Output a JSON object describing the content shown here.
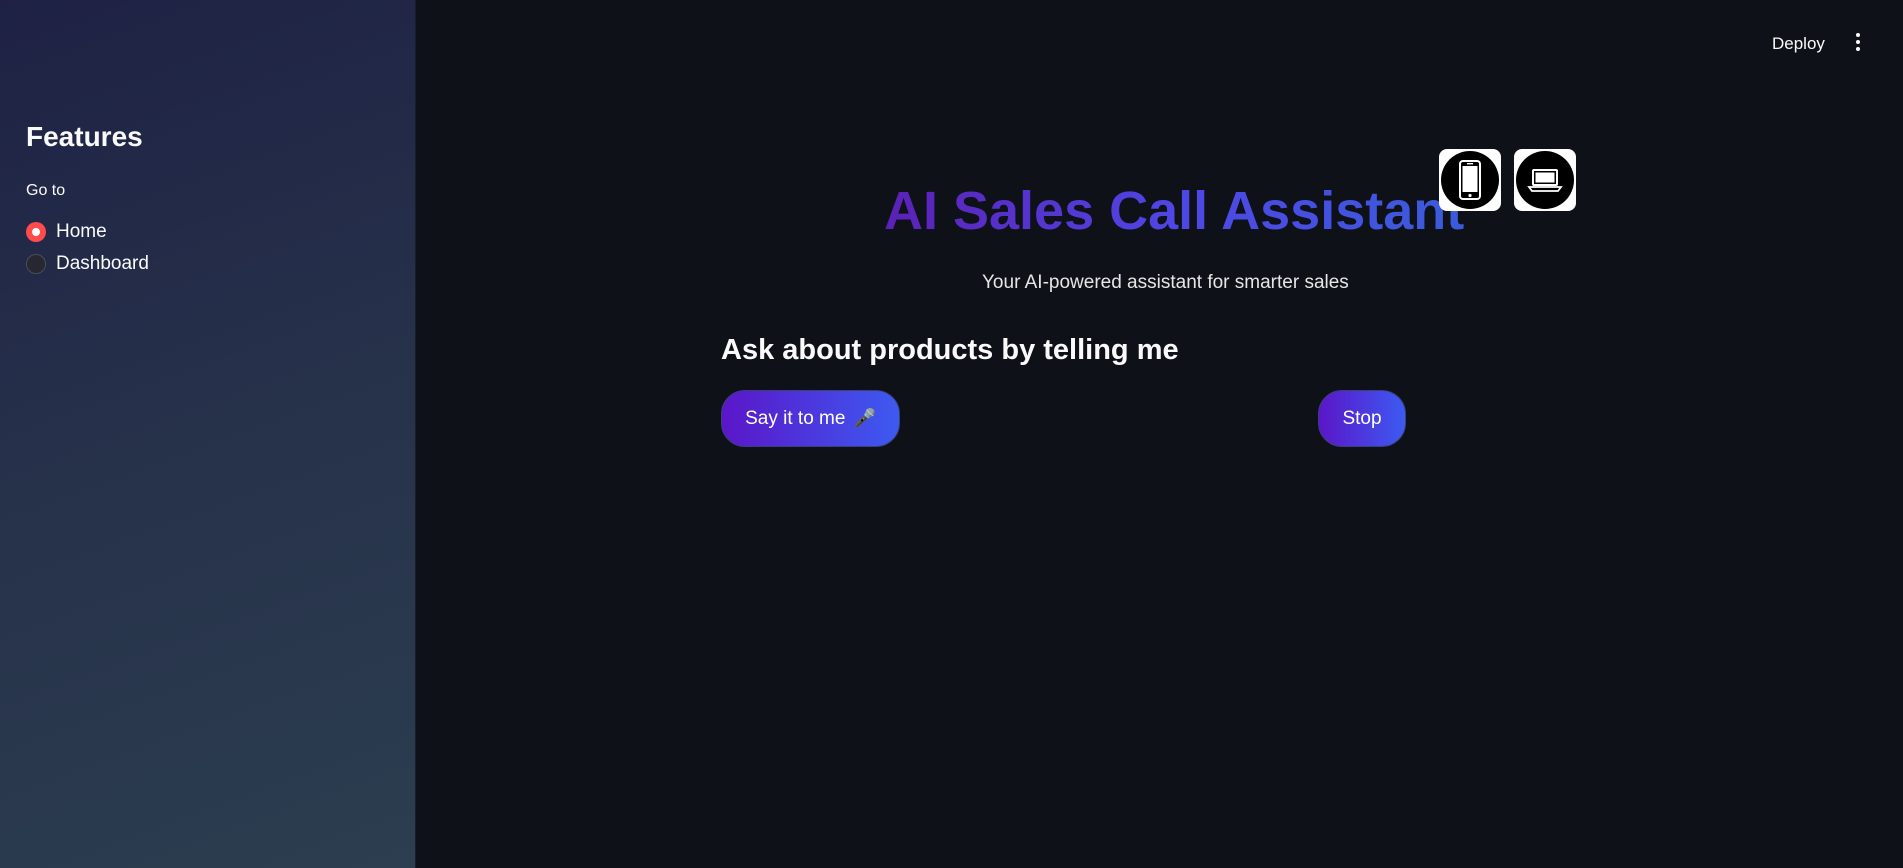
{
  "sidebar": {
    "title": "Features",
    "nav_label": "Go to",
    "options": [
      {
        "label": "Home",
        "selected": true
      },
      {
        "label": "Dashboard",
        "selected": false
      }
    ]
  },
  "header": {
    "deploy_label": "Deploy",
    "menu_icon": "more-vertical-icon"
  },
  "main": {
    "title": "AI Sales Call Assistant",
    "subtitle": "Your AI-powered assistant for smarter sales",
    "icons": [
      "smartphone-icon",
      "laptop-icon"
    ],
    "section_heading": "Ask about products by telling me",
    "say_button_label": "Say it to me",
    "say_button_icon": "🎤",
    "stop_button_label": "Stop"
  },
  "colors": {
    "accent": "#ff4b4b",
    "button_gradient_start": "#5b16c9",
    "button_gradient_end": "#3d5af1",
    "title_gradient_start": "#5b21b6",
    "title_gradient_end": "#3b5bdb",
    "background": "#0e1117"
  }
}
